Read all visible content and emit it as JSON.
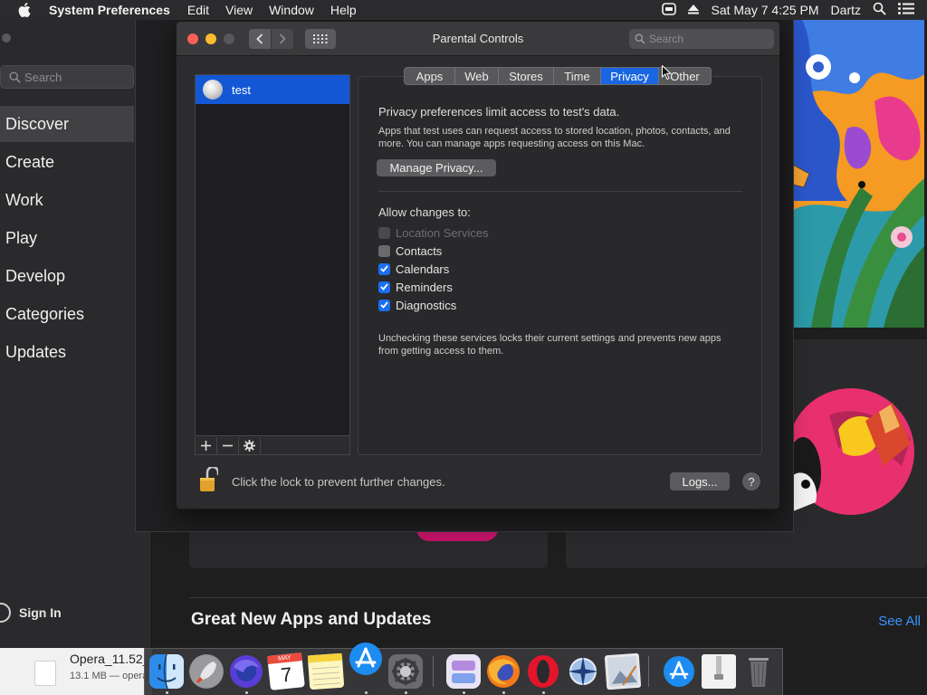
{
  "menubar": {
    "app_name": "System Preferences",
    "menus": [
      "Edit",
      "View",
      "Window",
      "Help"
    ],
    "datetime": "Sat May 7  4:25 PM",
    "user": "Dartz"
  },
  "appstore": {
    "search_placeholder": "Search",
    "nav": [
      "Discover",
      "Create",
      "Work",
      "Play",
      "Develop",
      "Categories",
      "Updates"
    ],
    "active_nav": "Discover",
    "sign_in": "Sign In",
    "section_heading": "Great New Apps and Updates",
    "see_all": "See All"
  },
  "window": {
    "title": "Parental Controls",
    "search_placeholder": "Search",
    "users": [
      "test"
    ],
    "tabs": [
      "Apps",
      "Web",
      "Stores",
      "Time",
      "Privacy",
      "Other"
    ],
    "selected_tab": "Privacy",
    "privacy": {
      "heading": "Privacy preferences limit access to test's data.",
      "description": "Apps that test uses can request access to stored location, photos, contacts, and more. You can manage apps requesting access on this Mac.",
      "manage_button": "Manage Privacy...",
      "allow_label": "Allow changes to:",
      "services": [
        {
          "label": "Location Services",
          "checked": false,
          "enabled": false
        },
        {
          "label": "Contacts",
          "checked": false,
          "enabled": true
        },
        {
          "label": "Calendars",
          "checked": true,
          "enabled": true
        },
        {
          "label": "Reminders",
          "checked": true,
          "enabled": true
        },
        {
          "label": "Diagnostics",
          "checked": true,
          "enabled": true
        }
      ],
      "note": "Unchecking these services locks their current settings and prevents new apps from getting access to them."
    },
    "lock_text": "Click the lock to prevent further changes.",
    "logs_button": "Logs...",
    "help_button": "?"
  },
  "download": {
    "name": "Opera_11.52_",
    "size": "13.1 MB — opera"
  },
  "dock": {
    "calendar_month": "MAY",
    "calendar_day": "7",
    "apps": [
      "finder-icon",
      "launchpad-icon",
      "firefox-nightly-icon",
      "calendar-icon",
      "notes-icon",
      "app-store-icon",
      "system-preferences-icon",
      "screens-icon",
      "firefox-icon",
      "opera-icon",
      "network-radar-icon",
      "preview-icon",
      "app-store-downloads-icon",
      "archive-icon",
      "trash-icon"
    ]
  },
  "colors": {
    "accent_blue": "#1a66e0",
    "selection_blue": "#1357d4",
    "link_blue": "#3b93ff"
  }
}
